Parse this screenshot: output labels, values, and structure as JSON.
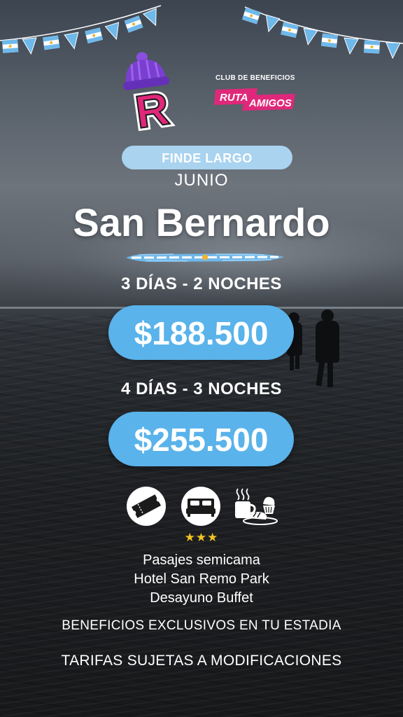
{
  "colors": {
    "accent_blue": "#5ab3ea",
    "pill_light_blue": "#a9d3ef",
    "brand_pink": "#e0287a",
    "brand_purple": "#7a3fd1",
    "star_gold": "#f3c322"
  },
  "branding": {
    "club_label": "CLUB DE BENEFICIOS",
    "ruta_label": "RUTA",
    "amigos_label": "AMIGOS",
    "logo_letter": "R"
  },
  "promo": {
    "tag": "FINDE LARGO",
    "month": "JUNIO",
    "destination": "San Bernardo"
  },
  "packages": [
    {
      "duration": "3 DÍAS - 2 NOCHES",
      "price": "$188.500"
    },
    {
      "duration": "4 DÍAS - 3 NOCHES",
      "price": "$255.500"
    }
  ],
  "icons": [
    "ticket-icon",
    "bed-icon",
    "breakfast-icon"
  ],
  "hotel_rating": "★★★",
  "features": [
    "Pasajes semicama",
    "Hotel San Remo Park",
    "Desayuno Buffet"
  ],
  "notes": {
    "benefits": "BENEFICIOS EXCLUSIVOS EN TU ESTADIA",
    "disclaimer": "TARIFAS SUJETAS A MODIFICACIONES"
  }
}
